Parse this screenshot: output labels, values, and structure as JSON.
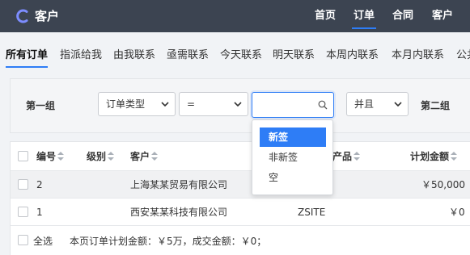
{
  "app": {
    "title": "客户",
    "brand_color": "#3c4451",
    "accent": "#2e7df6",
    "logo_icon": "c-logo-icon"
  },
  "topnav": [
    {
      "label": "首页",
      "active": false
    },
    {
      "label": "订单",
      "active": true
    },
    {
      "label": "合同",
      "active": false
    },
    {
      "label": "客户",
      "active": false
    }
  ],
  "subnav": [
    {
      "label": "所有订单",
      "active": true
    },
    {
      "label": "指派给我",
      "active": false
    },
    {
      "label": "由我联系",
      "active": false
    },
    {
      "label": "亟需联系",
      "active": false
    },
    {
      "label": "今天联系",
      "active": false
    },
    {
      "label": "明天联系",
      "active": false
    },
    {
      "label": "本周内联系",
      "active": false
    },
    {
      "label": "本月内联系",
      "active": false
    },
    {
      "label": "公共",
      "active": false
    }
  ],
  "filter": {
    "group1_label": "第一组",
    "field_select": "订单类型",
    "operator_select": "=",
    "value_input": "",
    "logic_select": "并且",
    "group2_label": "第二组",
    "dropdown_options": [
      {
        "label": "新签",
        "selected": true
      },
      {
        "label": "非新签",
        "selected": false
      },
      {
        "label": "空",
        "selected": false
      }
    ]
  },
  "table": {
    "columns": [
      "编号",
      "级别",
      "客户",
      "产品",
      "计划金额"
    ],
    "rows": [
      {
        "id": "2",
        "level": "",
        "customer": "上海某某贸易有限公司",
        "product": "",
        "amount": "￥50,000"
      },
      {
        "id": "1",
        "level": "",
        "customer": "西安某某科技有限公司",
        "product": "ZSITE",
        "amount": "￥0"
      }
    ],
    "footer": {
      "select_all": "全选",
      "summary": "本页订单计划金额：￥5万，成交金额：￥0；"
    }
  }
}
